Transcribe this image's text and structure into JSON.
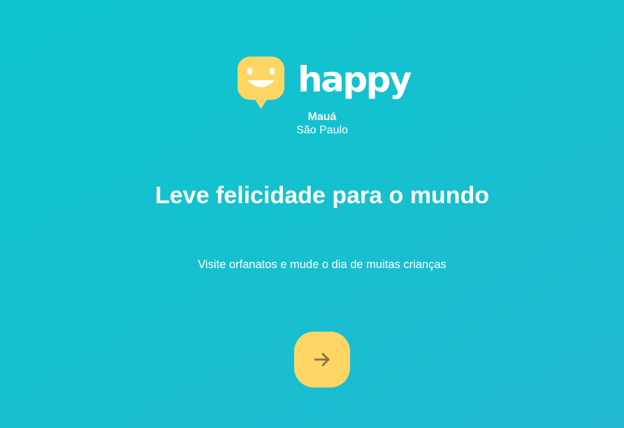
{
  "brand": {
    "name": "happy",
    "logo_icon": "smiling-speech-bubble-icon",
    "accent_color": "#ffd666"
  },
  "location": {
    "city": "Mauá",
    "state": "São Paulo"
  },
  "main": {
    "headline": "Leve felicidade para o mundo",
    "subtitle": "Visite orfanatos e mude o dia de muitas crianças"
  },
  "enter_button": {
    "icon": "arrow-right-icon",
    "icon_color": "#8d734b"
  },
  "colors": {
    "background_start": "#0ec4cc",
    "background_end": "#22b7d3",
    "text": "#ffffff"
  }
}
